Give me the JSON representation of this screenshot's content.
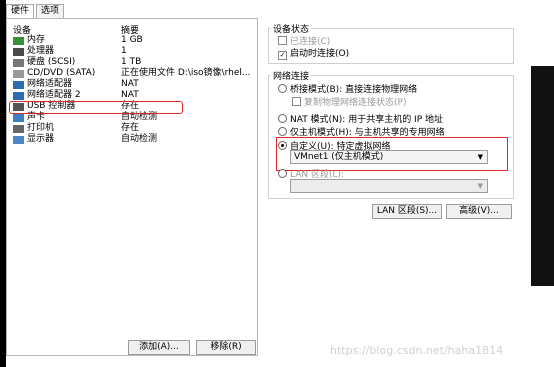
{
  "tabs": [
    "硬件",
    "选项"
  ],
  "columns": {
    "device": "设备",
    "summary": "摘要"
  },
  "devices": [
    {
      "icon": "memory-icon",
      "name": "内存",
      "summary": "1 GB"
    },
    {
      "icon": "processor-icon",
      "name": "处理器",
      "summary": "1"
    },
    {
      "icon": "hard-disk-icon",
      "name": "硬盘 (SCSI)",
      "summary": "1 TB"
    },
    {
      "icon": "cd-dvd-icon",
      "name": "CD/DVD (SATA)",
      "summary": "正在使用文件 D:\\iso镜像\\rhel..."
    },
    {
      "icon": "network-adapter-icon",
      "name": "网络适配器",
      "summary": "NAT"
    },
    {
      "icon": "network-adapter-icon",
      "name": "网络适配器 2",
      "summary": "NAT"
    },
    {
      "icon": "usb-icon",
      "name": "USB 控制器",
      "summary": "存在"
    },
    {
      "icon": "sound-card-icon",
      "name": "声卡",
      "summary": "自动检测"
    },
    {
      "icon": "printer-icon",
      "name": "打印机",
      "summary": "存在"
    },
    {
      "icon": "display-icon",
      "name": "显示器",
      "summary": "自动检测"
    }
  ],
  "buttons": {
    "add": "添加(A)...",
    "remove": "移除(R)",
    "lan_segments": "LAN 区段(S)...",
    "advanced": "高级(V)..."
  },
  "device_status": {
    "title": "设备状态",
    "connected": "已连接(C)",
    "connect_on_start": "启动时连接(O)"
  },
  "network": {
    "title": "网络连接",
    "bridged": "桥接模式(B): 直接连接物理网络",
    "replicate": "复制物理网络连接状态(P)",
    "nat": "NAT 模式(N): 用于共享主机的 IP 地址",
    "host_only": "仅主机模式(H): 与主机共享的专用网络",
    "custom": "自定义(U): 特定虚拟网络",
    "custom_value": "VMnet1 (仅主机模式)",
    "lan_segment": "LAN 区段(L):"
  },
  "watermark": "https://blog.csdn.net/haha1814"
}
